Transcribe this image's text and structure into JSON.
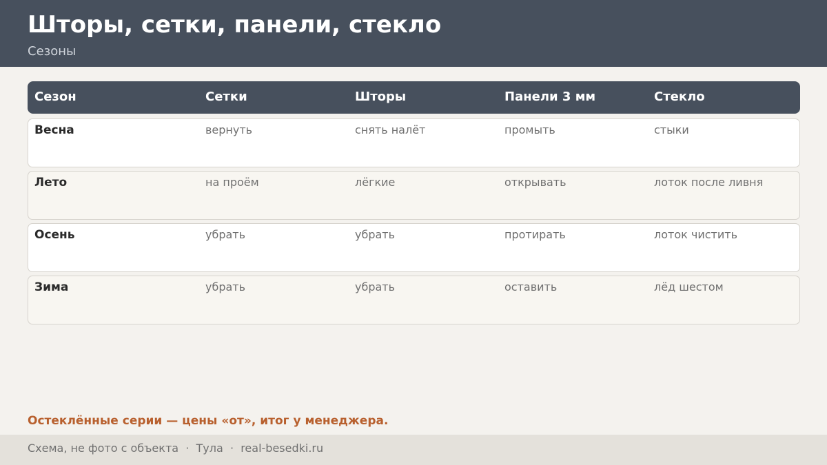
{
  "header": {
    "title": "Шторы, сетки, панели, стекло",
    "subtitle": "Сезоны"
  },
  "table": {
    "columns": [
      "Сезон",
      "Сетки",
      "Шторы",
      "Панели 3 мм",
      "Стекло"
    ],
    "rows": [
      [
        "Весна",
        "вернуть",
        "снять налёт",
        "промыть",
        "стыки"
      ],
      [
        "Лето",
        "на проём",
        "лёгкие",
        "открывать",
        "лоток после ливня"
      ],
      [
        "Осень",
        "убрать",
        "убрать",
        "протирать",
        "лоток чистить"
      ],
      [
        "Зима",
        "убрать",
        "убрать",
        "оставить",
        "лёд шестом"
      ]
    ]
  },
  "note": "Остеклённые серии — цены «от», итог у менеджера.",
  "footer": {
    "text": "Схема, не фото с объекта  ·  Тула  ·  real-besedki.ru"
  },
  "colors": {
    "header_bg": "#47505d",
    "accent": "#b8602e",
    "page_bg": "#f4f2ee",
    "footer_bg": "#e4e1db"
  }
}
